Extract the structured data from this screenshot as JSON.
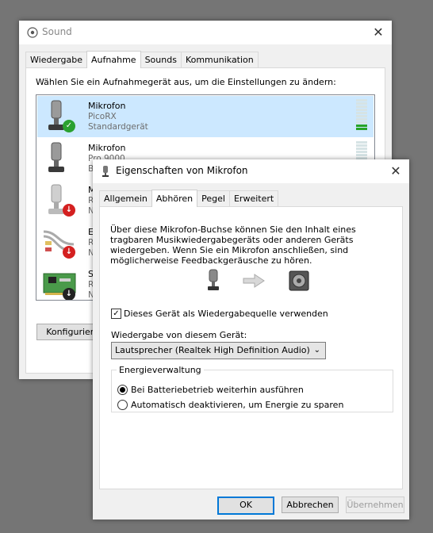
{
  "sound_window": {
    "title": "Sound",
    "tabs": [
      "Wiedergabe",
      "Aufnahme",
      "Sounds",
      "Kommunikation"
    ],
    "active_tab": "Aufnahme",
    "instruction": "Wählen Sie ein Aufnahmegerät aus, um die Einstellungen zu ändern:",
    "devices": [
      {
        "name": "Mikrofon",
        "line1": "PicoRX",
        "line2": "Standardgerät",
        "status": "default",
        "selected": true,
        "meter_level": 0.2
      },
      {
        "name": "Mikrofon",
        "line1": "Pro 9000",
        "line2": "B",
        "status": "ok",
        "selected": false,
        "meter_level": 0.0
      },
      {
        "name": "M",
        "line1": "R",
        "line2": "N",
        "status": "disabled",
        "selected": false
      },
      {
        "name": "E",
        "line1": "R",
        "line2": "N",
        "status": "disabled",
        "selected": false
      },
      {
        "name": "S",
        "line1": "R",
        "line2": "N",
        "status": "disconnected",
        "selected": false
      }
    ],
    "configure_button": "Konfigurieren"
  },
  "props_dialog": {
    "title": "Eigenschaften von Mikrofon",
    "tabs": [
      "Allgemein",
      "Abhören",
      "Pegel",
      "Erweitert"
    ],
    "active_tab": "Abhören",
    "description": "Über diese Mikrofon-Buchse können Sie den Inhalt eines tragbaren Musikwiedergabegeräts oder anderen Geräts wiedergeben. Wenn Sie ein Mikrofon anschließen, sind möglicherweise Feedbackgeräusche zu hören.",
    "listen_checkbox": {
      "label": "Dieses Gerät als Wiedergabequelle verwenden",
      "checked": true
    },
    "playback_label": "Wiedergabe von diesem Gerät:",
    "playback_device": "Lautsprecher (Realtek High Definition Audio)",
    "power_group": {
      "legend": "Energieverwaltung",
      "options": [
        "Bei Batteriebetrieb weiterhin ausführen",
        "Automatisch deaktivieren, um Energie zu sparen"
      ],
      "selected_index": 0
    },
    "buttons": {
      "ok": "OK",
      "cancel": "Abbrechen",
      "apply": "Übernehmen"
    },
    "apply_enabled": false
  },
  "colors": {
    "selection": "#cce8ff",
    "accent": "#0078d7",
    "ok_green": "#2aa130",
    "red_badge": "#d42020"
  },
  "icons": {
    "sound_window": "speaker-icon",
    "dialog": "microphone-icon",
    "close": "close-icon",
    "arrow": "arrow-right-icon",
    "speaker": "speaker-box-icon"
  }
}
